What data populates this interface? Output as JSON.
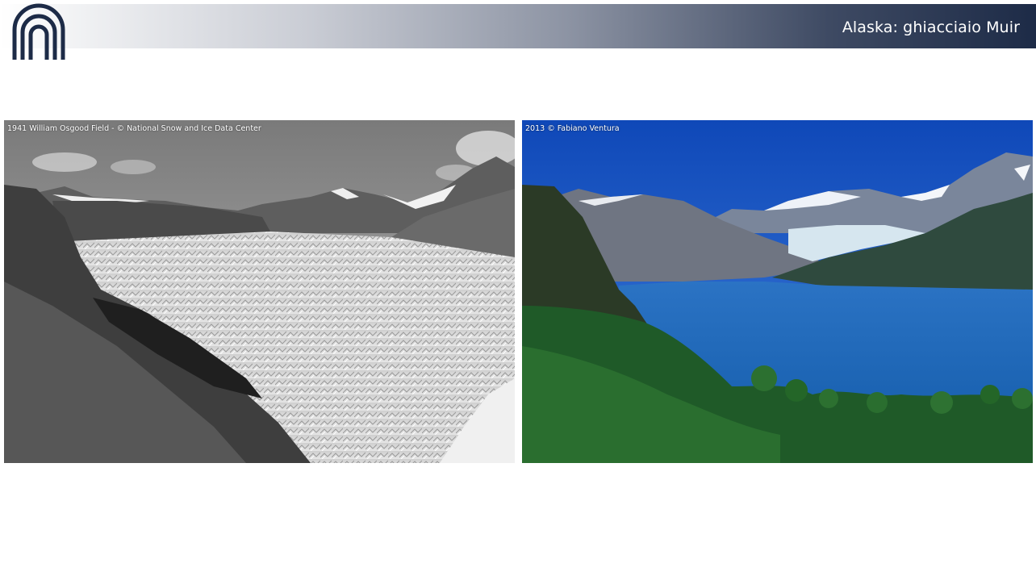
{
  "slide": {
    "title": "Alaska: ghiacciaio Muir"
  },
  "photos": [
    {
      "caption": "1941 William Osgood Field - © National Snow and Ice Data Center",
      "icon": "glacier-1941-photo"
    },
    {
      "caption": "2013 © Fabiano Ventura",
      "icon": "inlet-2013-photo"
    }
  ],
  "colors": {
    "header_dark": "#1d2b47",
    "logo_navy": "#1d2b47",
    "water_blue": "#1c65b5",
    "sky_blue": "#1a5fd0"
  }
}
